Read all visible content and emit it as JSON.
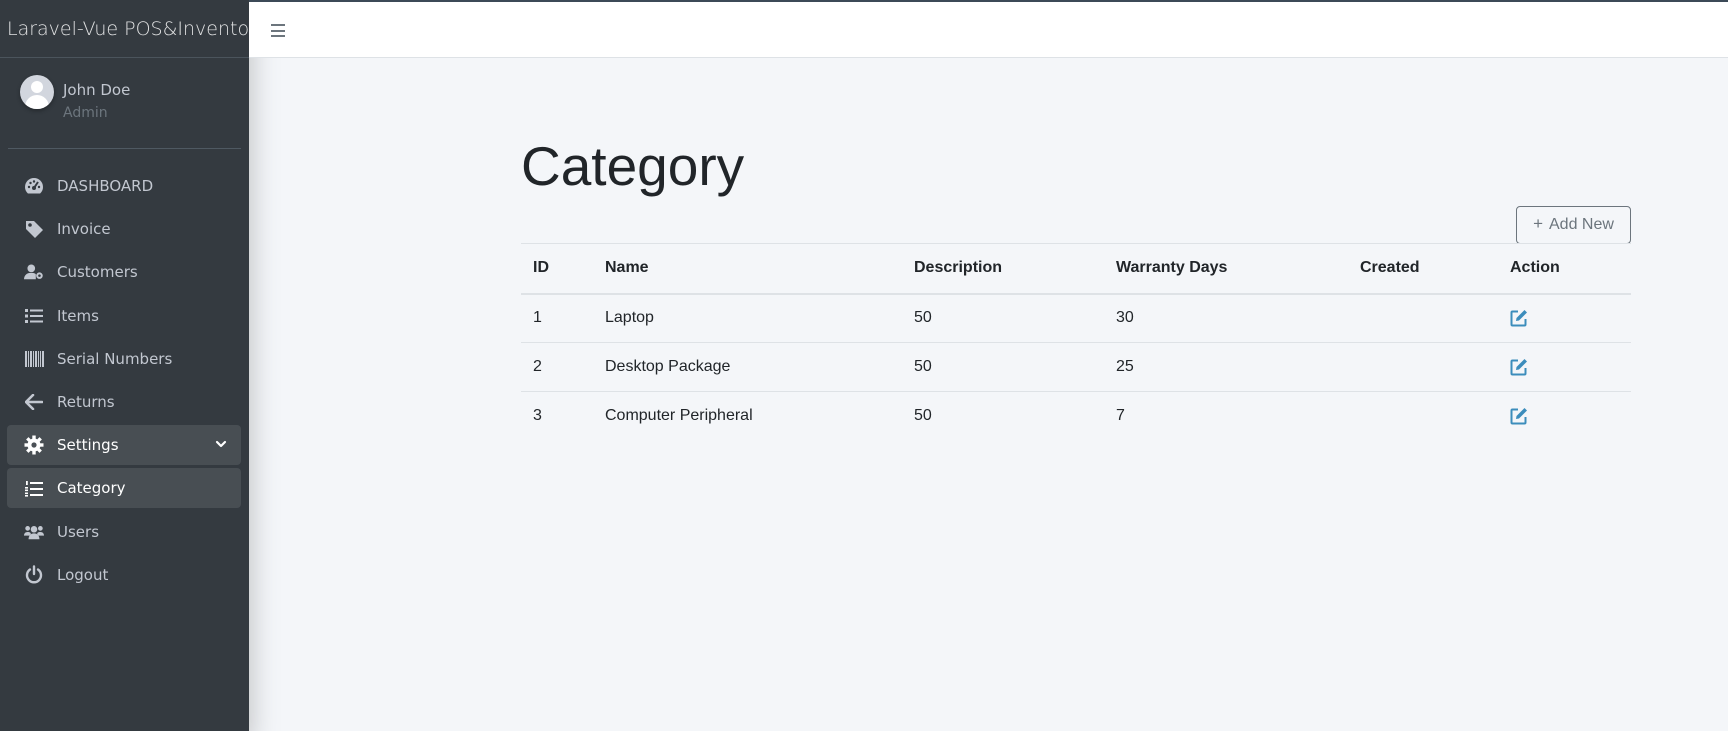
{
  "app": {
    "brand": "Laravel-Vue POS&Inventory"
  },
  "user": {
    "name": "John Doe",
    "role": "Admin"
  },
  "sidebar": {
    "items": [
      {
        "label": "DASHBOARD",
        "icon": "dashboard-icon"
      },
      {
        "label": "Invoice",
        "icon": "tag-icon"
      },
      {
        "label": "Customers",
        "icon": "user-cog-icon"
      },
      {
        "label": "Items",
        "icon": "list-icon"
      },
      {
        "label": "Serial Numbers",
        "icon": "barcode-icon"
      },
      {
        "label": "Returns",
        "icon": "arrow-left-icon"
      },
      {
        "label": "Settings",
        "icon": "gear-icon",
        "expanded": true
      },
      {
        "label": "Category",
        "icon": "list-ol-icon",
        "active": true
      },
      {
        "label": "Users",
        "icon": "users-icon"
      },
      {
        "label": "Logout",
        "icon": "power-icon"
      }
    ]
  },
  "page": {
    "title": "Category",
    "add_button": "Add New"
  },
  "table": {
    "columns": [
      "ID",
      "Name",
      "Description",
      "Warranty Days",
      "Created",
      "Action"
    ],
    "rows": [
      {
        "id": "1",
        "name": "Laptop",
        "description": "50",
        "warranty_days": "30",
        "created": ""
      },
      {
        "id": "2",
        "name": "Desktop Package",
        "description": "50",
        "warranty_days": "25",
        "created": ""
      },
      {
        "id": "3",
        "name": "Computer Peripheral",
        "description": "50",
        "warranty_days": "7",
        "created": ""
      }
    ]
  },
  "colors": {
    "sidebar_bg": "#343a40",
    "content_bg": "#f4f6f9",
    "link_blue": "#3c8dbc",
    "muted": "#6c757d"
  }
}
